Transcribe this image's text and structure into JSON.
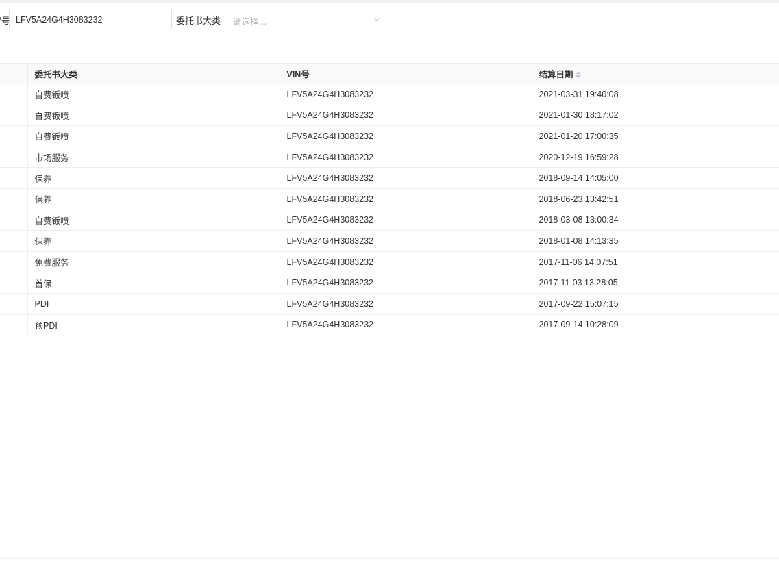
{
  "filters": {
    "vin_label_fragment": "号",
    "vin_value": "LFV5A24G4H3083232",
    "category_label": "委托书大类",
    "category_placeholder": "请选择..."
  },
  "table": {
    "columns": [
      "",
      "委托书大类",
      "VIN号",
      "结算日期"
    ],
    "rows": [
      {
        "category": "自费钣喷",
        "vin": "LFV5A24G4H3083232",
        "date": "2021-03-31 19:40:08"
      },
      {
        "category": "自费钣喷",
        "vin": "LFV5A24G4H3083232",
        "date": "2021-01-30 18:17:02"
      },
      {
        "category": "自费钣喷",
        "vin": "LFV5A24G4H3083232",
        "date": "2021-01-20 17:00:35"
      },
      {
        "category": "市场服务",
        "vin": "LFV5A24G4H3083232",
        "date": "2020-12-19 16:59:28"
      },
      {
        "category": "保养",
        "vin": "LFV5A24G4H3083232",
        "date": "2018-09-14 14:05:00"
      },
      {
        "category": "保养",
        "vin": "LFV5A24G4H3083232",
        "date": "2018-06-23 13:42:51"
      },
      {
        "category": "自费钣喷",
        "vin": "LFV5A24G4H3083232",
        "date": "2018-03-08 13:00:34"
      },
      {
        "category": "保养",
        "vin": "LFV5A24G4H3083232",
        "date": "2018-01-08 14:13:35"
      },
      {
        "category": "免费服务",
        "vin": "LFV5A24G4H3083232",
        "date": "2017-11-06 14:07:51"
      },
      {
        "category": "首保",
        "vin": "LFV5A24G4H3083232",
        "date": "2017-11-03 13:28:05"
      },
      {
        "category": "PDI",
        "vin": "LFV5A24G4H3083232",
        "date": "2017-09-22 15:07:15"
      },
      {
        "category": "预PDI",
        "vin": "LFV5A24G4H3083232",
        "date": "2017-09-14 10:28:09"
      }
    ]
  },
  "icons": {
    "select_arrow": "chevron-down-icon",
    "sort": "sort-caret-icon"
  }
}
